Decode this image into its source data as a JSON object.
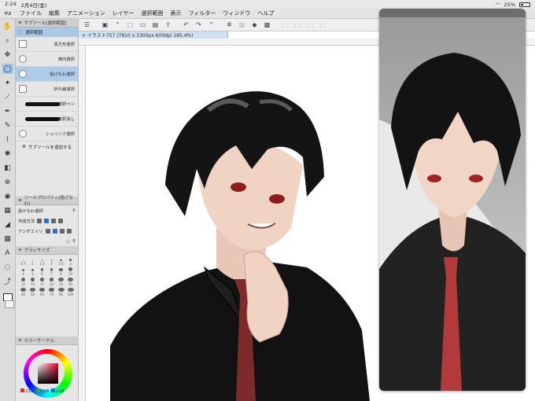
{
  "status": {
    "time": "2:24",
    "date": "2月4日(金)",
    "battery": "25%"
  },
  "menu": [
    "ファイル",
    "編集",
    "アニメーション",
    "レイヤー",
    "選択範囲",
    "表示",
    "フィルター",
    "ウィンドウ",
    "ヘルプ"
  ],
  "subtool_panel": {
    "header": "サブツール[選択範囲]",
    "group": "選択範囲",
    "items": [
      {
        "label": "長方形選択",
        "selected": false
      },
      {
        "label": "楕円選択",
        "selected": false
      },
      {
        "label": "投げなわ選択",
        "selected": true
      },
      {
        "label": "折れ線選択",
        "selected": false
      },
      {
        "label": "選択ペン",
        "selected": false
      },
      {
        "label": "選択消し",
        "selected": false
      },
      {
        "label": "シュリンク選択",
        "selected": false
      }
    ],
    "add_label": "サブツールを追加する"
  },
  "tool_property": {
    "header": "ツールプロパティ[投げなわ]",
    "title": "投げなわ選択",
    "row1_label": "作成方法",
    "row2_label": "アンチエイリ"
  },
  "brush_size": {
    "header": "ブラシサイズ",
    "sizes": [
      "0.7",
      "1",
      "1.5",
      "2",
      "2.5",
      "3",
      "4",
      "5",
      "6",
      "7",
      "8",
      "10",
      "12",
      "15",
      "17",
      "20",
      "25",
      "30",
      "40",
      "50",
      "60",
      "70",
      "80",
      "100"
    ]
  },
  "color": {
    "header": "カラーサークル",
    "r": "218",
    "g": "218",
    "b": "218"
  },
  "document": {
    "tab": "× イラスト757 (7810 x 3300px 600dpi 185.4%)"
  },
  "icons": {
    "toolbar": [
      "hand-icon",
      "zoom-icon",
      "move-icon",
      "lasso-icon",
      "wand-icon",
      "eyedropper-icon",
      "pen-icon",
      "pencil-icon",
      "brush-icon",
      "airbrush-icon",
      "eraser-icon",
      "blend-icon",
      "fill-icon",
      "gradient-icon",
      "figure-icon",
      "frame-icon",
      "text-icon",
      "balloon-icon",
      "correct-line-icon"
    ]
  }
}
